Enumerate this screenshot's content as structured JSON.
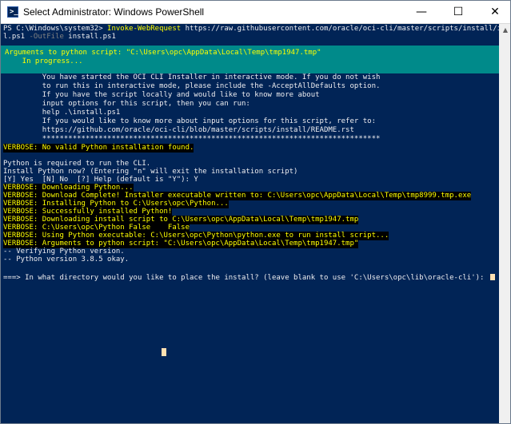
{
  "window": {
    "title": "Select Administrator: Windows PowerShell",
    "icon": "powershell-icon",
    "icon_glyph": ">_",
    "controls": {
      "minimize": "—",
      "maximize": "☐",
      "close": "✕"
    }
  },
  "console": {
    "prompt_line_1": {
      "prompt": "PS C:\\Windows\\system32> ",
      "command": "Invoke-WebRequest",
      "args": " https://raw.githubusercontent.com/oracle/oci-cli/master/scripts/install/instal"
    },
    "prompt_line_2": {
      "text": "l.ps1 ",
      "param": "-OutFile",
      "value": " install.ps1"
    },
    "progress": {
      "line_1": "Arguments to python script: \"C:\\Users\\opc\\AppData\\Local\\Temp\\tmp1947.tmp\"",
      "line_2": "    In progress..."
    },
    "info_lines": [
      "         You have started the OCI CLI Installer in interactive mode. If you do not wish",
      "         to run this in interactive mode, please include the -AcceptAllDefaults option.",
      "         If you have the script locally and would like to know more about",
      "         input options for this script, then you can run:",
      "         help .\\install.ps1",
      "         If you would like to know more about input options for this script, refer to:",
      "         https://github.com/oracle/oci-cli/blob/master/scripts/install/README.rst",
      "         ******************************************************************************"
    ],
    "verbose_no_python": "VERBOSE: No valid Python installation found.",
    "python_required": "Python is required to run the CLI.",
    "install_prompt": "Install Python now? (Entering \"n\" will exit the installation script)",
    "install_answer": "[Y] Yes  [N] No  [?] Help (default is \"Y\"): Y",
    "verbose_lines": [
      "VERBOSE: Downloading Python...",
      "VERBOSE: Download Complete! Installer executable written to: C:\\Users\\opc\\AppData\\Local\\Temp\\tmp8999.tmp.exe",
      "VERBOSE: Installing Python to C:\\Users\\opc\\Python...",
      "VERBOSE: Successfully installed Python!",
      "VERBOSE: Downloading install script to C:\\Users\\opc\\AppData\\Local\\Temp\\tmp1947.tmp",
      "VERBOSE: C:\\Users\\opc\\Python False    False",
      "VERBOSE: Using Python executable: C:\\Users\\opc\\Python\\python.exe to run install script...",
      "VERBOSE: Arguments to python script: \"C:\\Users\\opc\\AppData\\Local\\Temp\\tmp1947.tmp\""
    ],
    "verify_lines": [
      "-- Verifying Python version.",
      "-- Python version 3.8.5 okay."
    ],
    "directory_prompt": "===> In what directory would you like to place the install? (leave blank to use 'C:\\Users\\opc\\lib\\oracle-cli'): "
  },
  "colors": {
    "console_bg": "#012456",
    "console_fg": "#eeedf0",
    "progress_bg": "#008a8a",
    "highlight_fg": "#ffff00",
    "verbose_bg": "#000000",
    "param_fg": "#808080"
  }
}
